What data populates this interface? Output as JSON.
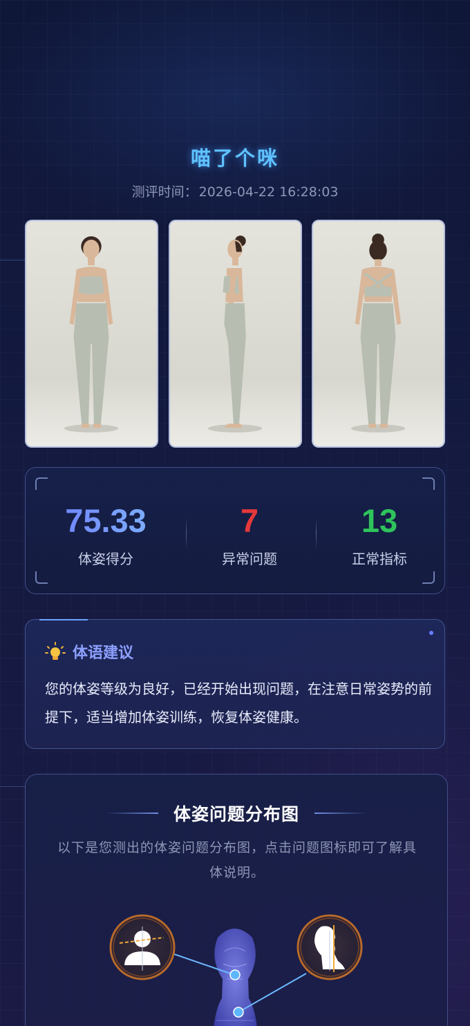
{
  "user": {
    "name": "喵了个咪",
    "time_label": "测评时间：",
    "time_value": "2026-04-22 16:28:03"
  },
  "photos": [
    {
      "view": "front"
    },
    {
      "view": "side"
    },
    {
      "view": "back"
    }
  ],
  "stats": [
    {
      "value": "75.33",
      "label": "体姿得分",
      "color": "#6f8dff"
    },
    {
      "value": "7",
      "label": "异常问题",
      "color": "#e5383a"
    },
    {
      "value": "13",
      "label": "正常指标",
      "color": "#2ec35b"
    }
  ],
  "advice": {
    "icon": "lightbulb-icon",
    "title": "体语建议",
    "text": "您的体姿等级为良好，已经开始出现问题，在注意日常姿势的前提下，适当增加体姿训练，恢复体姿健康。"
  },
  "distribution": {
    "title": "体姿问题分布图",
    "description": "以下是您测出的体姿问题分布图，点击问题图标即可了解具体说明。",
    "issues": [
      {
        "icon": "head-tilt-icon"
      },
      {
        "icon": "forward-head-icon"
      }
    ]
  }
}
